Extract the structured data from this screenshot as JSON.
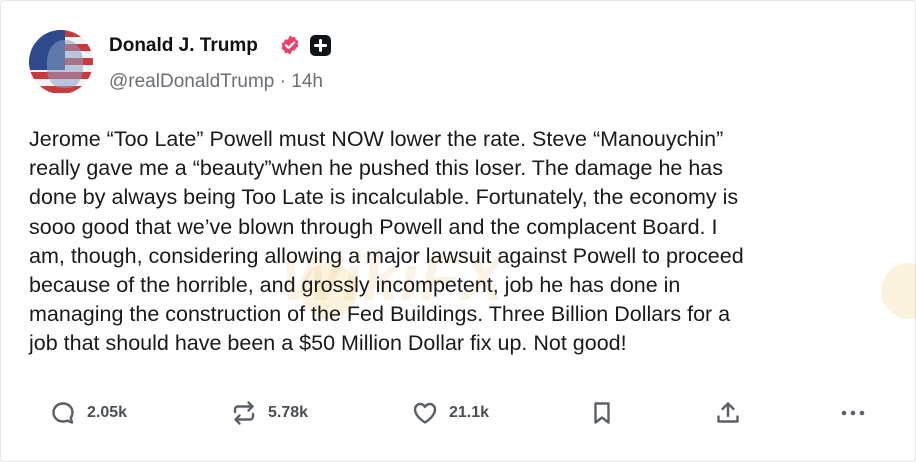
{
  "post": {
    "author_name": "Donald J. Trump",
    "handle_time": "@realDonaldTrump · 14h",
    "body_lines": [
      "Jerome “Too Late” Powell must NOW lower the rate. Steve “Manouychin”",
      "really gave me a “beauty”when he pushed this loser. The damage he has",
      "done by always being Too Late is incalculable. Fortunately, the economy is",
      "sooo good that we’ve blown through Powell and the complacent Board. I",
      "am, though, considering allowing a major lawsuit against Powell to proceed",
      "because of the horrible, and grossly incompetent, job he has done in",
      "managing the construction of the Fed Buildings. Three Billion Dollars for a",
      "job that should have been a $50 Million Dollar fix up. Not good!"
    ]
  },
  "actions": {
    "replies": "2.05k",
    "reposts": "5.78k",
    "likes": "21.1k"
  },
  "watermark": "WikiFX",
  "icons": {
    "verified": "verified-badge-icon",
    "plus": "plus-badge-icon",
    "reply": "comment-icon",
    "repost": "repost-icon",
    "like": "heart-icon",
    "bookmark": "bookmark-icon",
    "share": "share-icon",
    "more": "more-icon"
  },
  "colors": {
    "verified_badge": "#ef3e6c",
    "text_primary": "#0f1419",
    "text_secondary": "#6b7075",
    "icon_gray": "#5b6066"
  }
}
